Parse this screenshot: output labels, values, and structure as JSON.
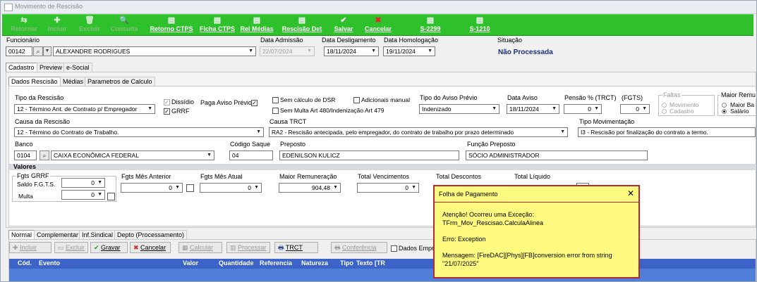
{
  "window": {
    "title": "Movimento de Rescisão"
  },
  "toolbar": [
    {
      "label": "Retornar",
      "icon": "back-arrow-icon",
      "glyph": "⇆",
      "enabled": false
    },
    {
      "label": "Incluir",
      "icon": "add-icon",
      "glyph": "✚",
      "enabled": false
    },
    {
      "label": "Excluir",
      "icon": "trash-icon",
      "glyph": "🗑",
      "enabled": false
    },
    {
      "label": "Consulta",
      "icon": "magnifier-icon",
      "glyph": "🔍",
      "enabled": false
    },
    {
      "label": "Retorno CTPS",
      "icon": "document-icon",
      "glyph": "▤",
      "enabled": true
    },
    {
      "label": "Ficha CTPS",
      "icon": "document-icon",
      "glyph": "▤",
      "enabled": true
    },
    {
      "label": "Rel Médias",
      "icon": "document-icon",
      "glyph": "▤",
      "enabled": true
    },
    {
      "label": "Rescisão Det",
      "icon": "document-icon",
      "glyph": "▤",
      "enabled": true
    },
    {
      "label": "Salvar",
      "icon": "checkmark-icon",
      "glyph": "✔",
      "enabled": true
    },
    {
      "label": "Cancelar",
      "icon": "x-icon",
      "glyph": "✖",
      "enabled": true
    },
    {
      "label": "S-2299",
      "icon": "esocial-document-icon",
      "glyph": "▤",
      "enabled": true
    },
    {
      "label": "S-1210",
      "icon": "esocial-document-icon",
      "glyph": "▤",
      "enabled": true
    }
  ],
  "header": {
    "funcionario_label": "Funcionário",
    "funcionario_code": "00142",
    "funcionario_name": "ALEXANDRE RODRIGUES",
    "data_admissao_label": "Data Admissão",
    "data_admissao": "22/07/2024",
    "data_desligamento_label": "Data Desligamento",
    "data_desligamento": "18/11/2024",
    "data_homologacao_label": "Data Homologação",
    "data_homologacao": "19/11/2024",
    "situacao_label": "Situação",
    "situacao": "Não Processada"
  },
  "main_tabs": [
    "Cadastro",
    "Preview",
    "e-Social"
  ],
  "sub_tabs": [
    "Dados Rescisão",
    "Médias",
    "Parametros de Calculo"
  ],
  "rescisao": {
    "tipo_rescisao_label": "Tipo da Rescisão",
    "tipo_rescisao": "12 - Término Ant. de Contrato p/ Empregador",
    "dissidio_label": "Dissídio",
    "grrf_label": "GRRF",
    "paga_aviso_label": "Paga Aviso Prévio",
    "sem_calculo_dsr_label": "Sem cálculo de DSR",
    "adicionais_manual_label": "Adicionais manual",
    "sem_multa_label": "Sem Multa Art 480/Indenização Art 479",
    "tipo_aviso_label": "Tipo do Aviso Prévio",
    "tipo_aviso": "Indenizado",
    "data_aviso_label": "Data Aviso",
    "data_aviso": "18/11/2024",
    "pensao_label": "Pensão % (TRCT)",
    "pensao_value": "0",
    "fgts_label": "(FGTS)",
    "fgts_value": "0",
    "faltas_label": "Faltas",
    "faltas_options": [
      "Movimento",
      "Cadastro"
    ],
    "maior_remu_label": "Maior Remu",
    "maior_remu_options": [
      "Maior Ba",
      "Salário"
    ],
    "causa_rescisao_label": "Causa da Rescisão",
    "causa_rescisao": "12 - Término do Contrato de Trabalho.",
    "causa_trct_label": "Causa TRCT",
    "causa_trct": "RA2 - Rescisão antecipada, pelo empregador, do contrato de trabalho por prazo determinado",
    "tipo_movimentacao_label": "Tipo Movimentação",
    "tipo_movimentacao": "I3 - Rescisão por finalização do contrato a termo.",
    "banco_label": "Banco",
    "banco_code": "0104",
    "banco_name": "CAIXA ECONÔMICA FEDERAL",
    "codigo_saque_label": "Código Saque",
    "codigo_saque": "04",
    "preposto_label": "Preposto",
    "preposto": "EDENILSON KULICZ",
    "funcao_preposto_label": "Função Preposto",
    "funcao_preposto": "SÓCIO ADMINISTRADOR"
  },
  "valores": {
    "section_label": "Valores",
    "fgts_grrf_label": "Fgts GRRF",
    "saldo_fgts_label": "Saldo F.G.T.S.",
    "saldo_fgts": "0",
    "multa_label": "Multa",
    "multa": "0",
    "fgts_mes_anterior_label": "Fgts Mês Anterior",
    "fgts_mes_anterior": "0",
    "fgts_mes_atual_label": "Fgts Mês Atual",
    "fgts_mes_atual": "0",
    "maior_remuneracao_label": "Maior Remuneração",
    "maior_remuneracao": "904,48",
    "total_vencimentos_label": "Total Vencimentos",
    "total_vencimentos": "0",
    "total_descontos_label": "Total Descontos",
    "total_liquido_label": "Total Líquido"
  },
  "bottom_tabs": [
    "Normal",
    "Complementar",
    "Inf.Sindical",
    "Depto (Processamento)"
  ],
  "bottom_buttons": [
    {
      "label": "Incluir",
      "icon": "add-icon",
      "glyph": "✚",
      "enabled": false
    },
    {
      "label": "Excluir",
      "icon": "minus-icon",
      "glyph": "▭",
      "enabled": false
    },
    {
      "label": "Gravar",
      "icon": "checkmark-icon",
      "glyph": "✔",
      "enabled": true
    },
    {
      "label": "Cancelar",
      "icon": "x-icon",
      "glyph": "✖",
      "enabled": true
    },
    {
      "label": "Calcular",
      "icon": "calculator-icon",
      "glyph": "▦",
      "enabled": false
    },
    {
      "label": "Processar",
      "icon": "process-icon",
      "glyph": "▥",
      "enabled": false
    },
    {
      "label": "TRCT",
      "icon": "printer-icon",
      "glyph": "🖶",
      "enabled": true
    },
    {
      "label": "Conferência",
      "icon": "printer-icon",
      "glyph": "🖶",
      "enabled": false
    }
  ],
  "dados_empre_label": "Dados Empre",
  "grid_columns": [
    "Cód.",
    "Evento",
    "Valor",
    "Quantidade",
    "Referencia",
    "Natureza",
    "Tipo",
    "Texto [TR"
  ],
  "popup": {
    "title": "Folha de Pagamento",
    "line1": "Atenção! Ocorreu uma Exceção:",
    "line2": "TFrm_Mov_Rescisao.CalculaAlinea",
    "line3": "Erro: Exception",
    "line4": "Mensagem: [FireDAC][Phys][FB]conversion error from string",
    "line5": "\"21/07/2025\""
  },
  "colors": {
    "toolbar_green": "#2fc12b",
    "popup_bg": "#fffb80",
    "popup_border": "#b8292f",
    "grid_header": "#3b63c8",
    "situacao_text": "#1a2f7a"
  }
}
